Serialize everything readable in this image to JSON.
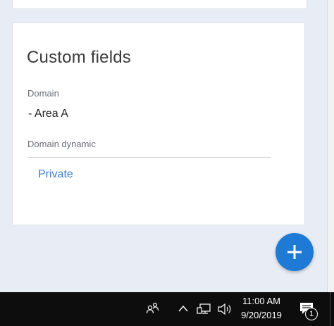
{
  "card": {
    "title": "Custom fields",
    "fields": [
      {
        "label": "Domain",
        "value": "- Area A"
      },
      {
        "label": "Domain dynamic",
        "value": "Private"
      }
    ]
  },
  "fab": {
    "icon": "plus-icon"
  },
  "taskbar": {
    "icons": [
      "people-icon",
      "chevron-up-icon",
      "network-icon",
      "volume-icon",
      "notification-icon"
    ],
    "clock_time": "11:00 AM",
    "clock_date": "9/20/2019",
    "notification_count": "1"
  },
  "colors": {
    "page_background": "#e8ecf4",
    "card_background": "#ffffff",
    "link": "#3d7fcf",
    "fab": "#1f7ad6",
    "taskbar": "#0d0d0d"
  }
}
